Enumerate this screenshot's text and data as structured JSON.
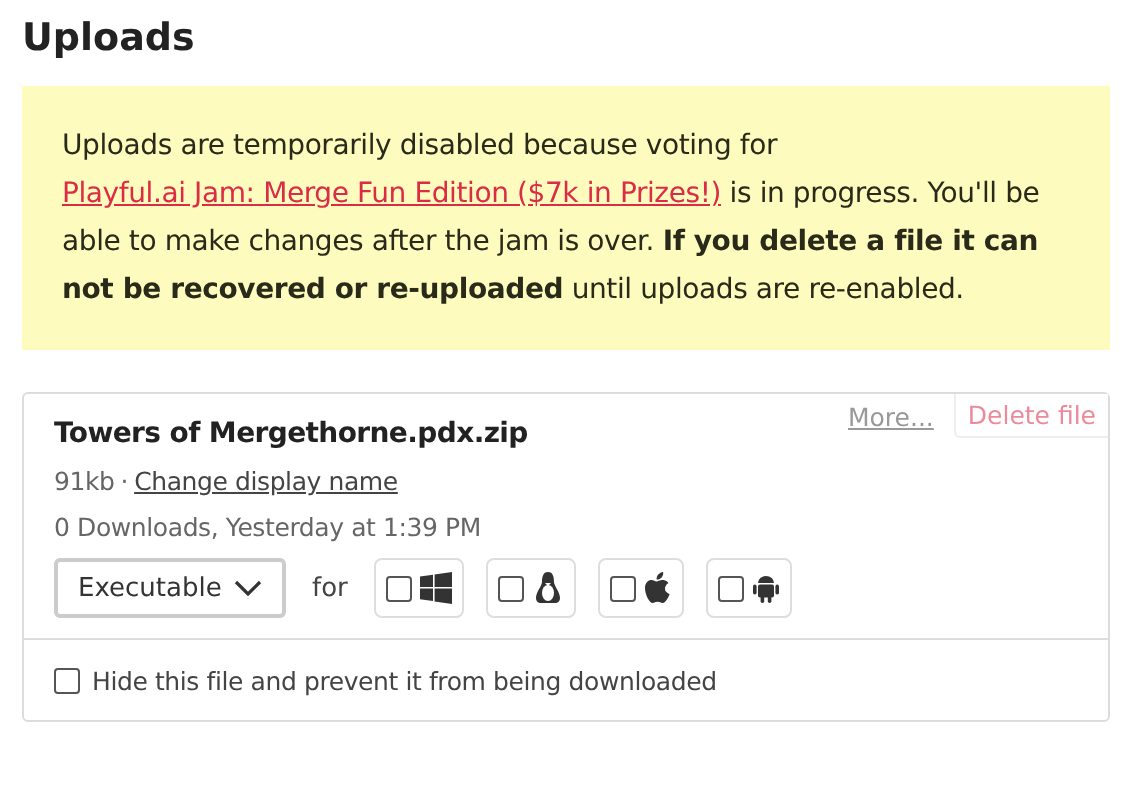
{
  "title": "Uploads",
  "notice": {
    "before": "Uploads are temporarily disabled because voting for",
    "link": "Playful.ai Jam: Merge Fun Edition ($7k in Prizes!)",
    "after": "is in progress. You'll be able to make changes after the jam is over. **If you delete a file it can not be recovered or re-uploaded** until uploads are re-enabled."
  },
  "upload": {
    "more": "More...",
    "delete": "Delete file",
    "filename": "Towers of Mergethorne.pdx.zip",
    "size": "91kb",
    "separator": "·",
    "change_name": "Change display name",
    "stats": "0 Downloads, Yesterday at 1:39 PM",
    "type": "Executable",
    "for": "for",
    "platforms": [
      {
        "kind": "windows",
        "checked": false
      },
      {
        "kind": "linux",
        "checked": false
      },
      {
        "kind": "mac",
        "checked": false
      },
      {
        "kind": "android",
        "checked": false
      }
    ],
    "hide": {
      "label": "Hide this file and prevent it from being downloaded",
      "checked": false
    }
  }
}
